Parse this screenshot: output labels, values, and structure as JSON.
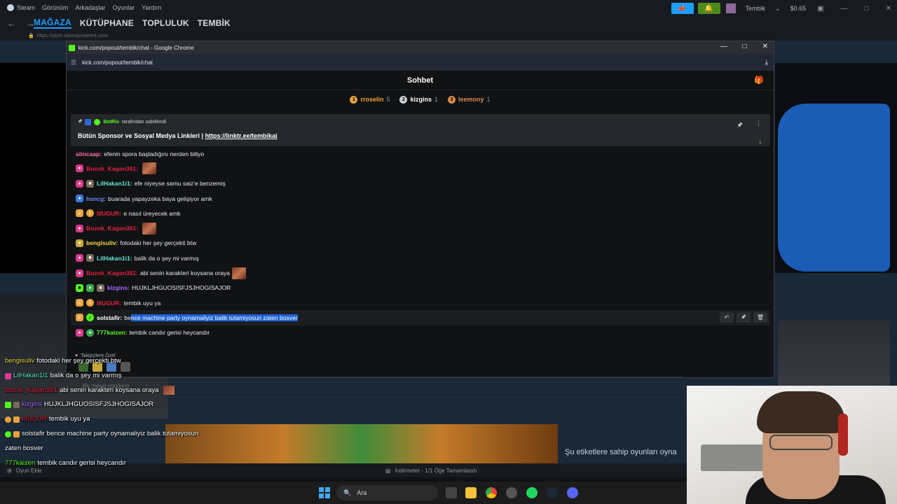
{
  "steam": {
    "menu": [
      "Steam",
      "Görünüm",
      "Arkadaşlar",
      "Oyunlar",
      "Yardım"
    ],
    "user": {
      "name": "Tembik",
      "balance": "$0.65"
    },
    "nav_tabs": [
      "MAĞAZA",
      "KÜTÜPHANE",
      "TOPLULUK",
      "TEMBİK"
    ],
    "url": "https://store.steampowered.com/",
    "add_game": "Oyun Ekle",
    "downloads": "İndirmeler - 1/1 Öğe Tamamlandı",
    "tags_text": "Şu etiketlere sahip oyunları oyna"
  },
  "chrome": {
    "title": "kick.com/popout/tembik/chat - Google Chrome",
    "url": "kick.com/popout/tembik/chat"
  },
  "chat": {
    "header": "Sohbet",
    "leaderboard": [
      {
        "rank": "1",
        "name": "rroselin",
        "count": "5",
        "color": "#e8a23b"
      },
      {
        "rank": "2",
        "name": "kizgins",
        "count": "1",
        "color": "#c9cdd2"
      },
      {
        "rank": "3",
        "name": "leemony",
        "count": "1",
        "color": "#d98a4e"
      }
    ],
    "pinned": {
      "by": "BotRix",
      "by_suffix": "tarafından sabitlendi",
      "text": "Bütün Sponsor ve Sosyal Medya Linkleri | ",
      "link": "https://linktr.ee/tembikai"
    },
    "messages": [
      {
        "name": "siincaap:",
        "color": "#ff6eb1",
        "text": "efenin spora başladığını nerden biliyo"
      },
      {
        "name": "Bozok_Kagan361:",
        "color": "#e0233b",
        "text": ""
      },
      {
        "name": "LilHakan1i1:",
        "color": "#65e8d8",
        "text": "efe niyeyse samu saiz'e benzemiş"
      },
      {
        "name": "hsncg:",
        "color": "#6a8dff",
        "text": "buarada yapayzeka baya gelişiyor amk"
      },
      {
        "name": "IIIUGUR:",
        "color": "#e0233b",
        "text": "e nasıl üreyecek amk"
      },
      {
        "name": "Bozok_Kagan361:",
        "color": "#e0233b",
        "text": ""
      },
      {
        "name": "bengisuliv:",
        "color": "#f0d84a",
        "text": "fotodaki her şey gerçekti btw"
      },
      {
        "name": "LilHakan1i1:",
        "color": "#65e8d8",
        "text": "balik da o şey mi varmış"
      },
      {
        "name": "Bozok_Kagan361:",
        "color": "#e0233b",
        "text": "abi senin karakteri koysana oraya"
      },
      {
        "name": "kizgins:",
        "color": "#b06cff",
        "text": "HUJKLJHGUOSISFJSJHOGISAJOR"
      },
      {
        "name": "IIIUGUR:",
        "color": "#e0233b",
        "text": "tembik uyu ya"
      },
      {
        "name": "solstafir:",
        "color": "#ffffff",
        "text_plain": "be",
        "text_selected": "nce machine party oynamaliyiz balik tutamiyosun zaten bosver"
      },
      {
        "name": "777kaizen:",
        "color": "#53fc18",
        "text": "tembik candır gerisi heycandır"
      }
    ],
    "followers_label": "Takipçilere Özel",
    "input_placeholder": "Bir mesaj gönderin"
  },
  "overlay": [
    {
      "name": "bengisuliv",
      "color": "#f0d84a",
      "text": "fotodaki her şey gerçekti btw"
    },
    {
      "name": "LilHakan1i1",
      "color": "#65e8d8",
      "text": "balik da o şey mi varmış"
    },
    {
      "name": "Bozok_Kagan361",
      "color": "#e0233b",
      "text": "abi senin karakteri koysana oraya"
    },
    {
      "name": "kizgins",
      "color": "#b06cff",
      "text": "HUJKLJHGUOSISFJSJHOGISAJOR"
    },
    {
      "name": "IIIUGUR",
      "color": "#e0233b",
      "text": "tembik uyu ya"
    },
    {
      "name": "solstafir",
      "color": "#ffffff",
      "text": "bence machine party oynamaliyiz balik tutamiyosun"
    },
    {
      "name": "",
      "color": "#ffffff",
      "text": "zaten bosver"
    },
    {
      "name": "777kaizen",
      "color": "#53fc18",
      "text": "tembik candır gerisi heycandır"
    }
  ],
  "taskbar": {
    "search": "Ara"
  }
}
